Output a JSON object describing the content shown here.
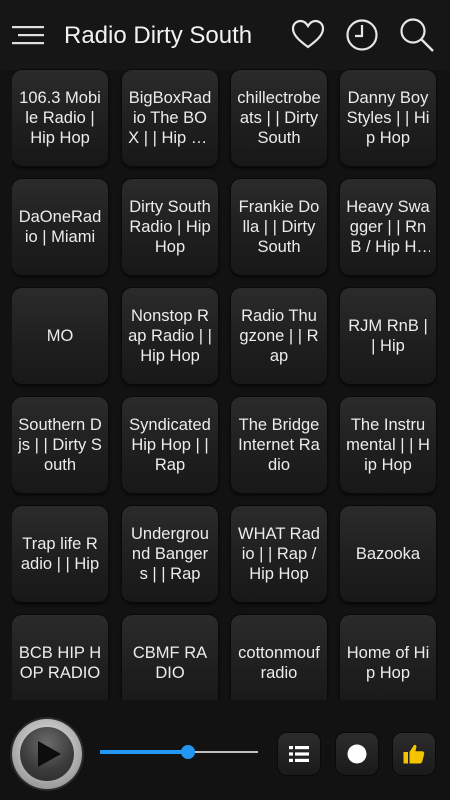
{
  "app": {
    "title": "Radio Dirty South"
  },
  "header_icons": [
    "menu-icon",
    "heart-icon",
    "clock-icon",
    "search-icon"
  ],
  "stations": [
    "106.3 Mobile Radio | Hip Hop",
    "BigBoxRadio The BOX | | Hip Hop",
    "chillectrobeats | | Dirty South",
    "Danny Boy Styles | | Hip Hop",
    "DaOneRadio | Miami",
    "Dirty South Radio | Hip Hop",
    "Frankie Dolla | | Dirty South",
    "Heavy Swagger | | RnB / Hip Hop",
    "MO",
    "Nonstop Rap Radio | | Hip Hop",
    "Radio Thugzone | | Rap",
    "RJM RnB | | Hip",
    "Southern Djs | | Dirty South",
    "Syndicated Hip Hop | | Rap",
    "The Bridge Internet Radio",
    "The Instrumental | | Hip Hop",
    "Trap life Radio | | Hip",
    "Underground Bangers | | Rap",
    "WHAT Radio | | Rap / Hip Hop",
    "Bazooka",
    "BCB HIP HOP RADIO",
    "CBMF RADIO",
    "cottonmoufradio",
    "Home of Hip Hop"
  ],
  "player": {
    "volume": 0.56,
    "accent": "#2196f3",
    "controls": [
      "play-icon",
      "list-icon",
      "record-icon",
      "thumbs-up-icon"
    ]
  }
}
